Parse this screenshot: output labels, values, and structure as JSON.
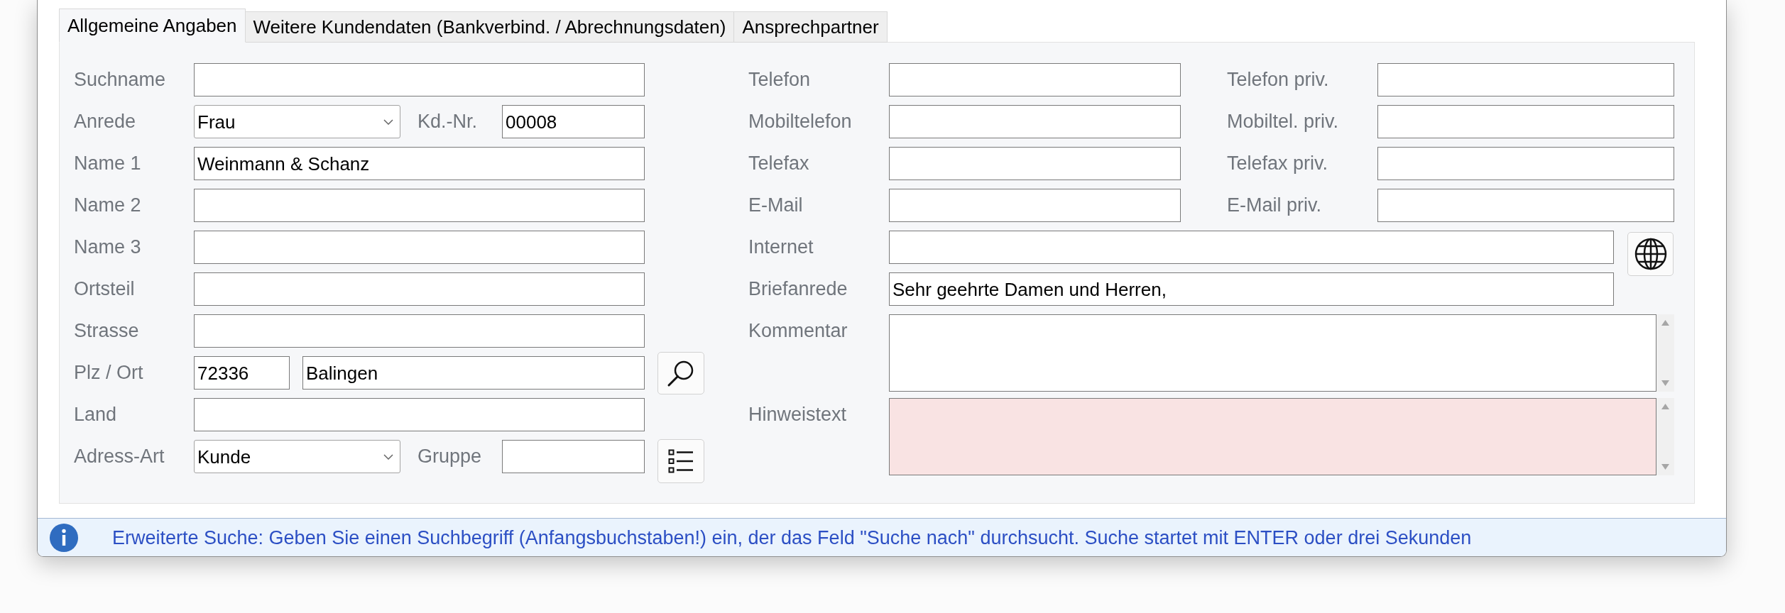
{
  "tabs": [
    {
      "label": "Allgemeine Angaben",
      "selected": true
    },
    {
      "label": "Weitere Kundendaten (Bankverbind. / Abrechnungsdaten)",
      "selected": false
    },
    {
      "label": "Ansprechpartner",
      "selected": false
    }
  ],
  "left_rows": [
    {
      "kind": "wide",
      "label": "Suchname"
    },
    {
      "kind": "split",
      "label": "Anrede",
      "select_value": "Frau",
      "label_2": "Kd.-Nr.",
      "value_2": "00008"
    },
    {
      "kind": "wide",
      "label": "Name 1",
      "value": "Weinmann & Schanz"
    },
    {
      "kind": "wide",
      "label": "Name 2"
    },
    {
      "kind": "wide",
      "label": "Name 3"
    },
    {
      "kind": "wide",
      "label": "Ortsteil"
    },
    {
      "kind": "wide",
      "label": "Strasse"
    },
    {
      "kind": "postal",
      "label": "Plz / Ort",
      "value": "72336",
      "value_2": "Balingen",
      "button": {
        "kind": "search"
      }
    },
    {
      "kind": "wide",
      "label": "Land"
    },
    {
      "kind": "split",
      "label": "Adress-Art",
      "select_value": "Kunde",
      "label_2": "Gruppe",
      "button": {
        "kind": "list"
      }
    }
  ],
  "right_rows": [
    {
      "kind": "pair",
      "label": "Telefon",
      "label_2": "Telefon priv."
    },
    {
      "kind": "pair",
      "label": "Mobiltelefon",
      "label_2": "Mobiltel. priv."
    },
    {
      "kind": "pair",
      "label": "Telefax",
      "label_2": "Telefax priv."
    },
    {
      "kind": "pair",
      "label": "E-Mail",
      "label_2": "E-Mail priv."
    },
    {
      "kind": "wide",
      "label": "Internet",
      "button": {
        "kind": "globe"
      }
    },
    {
      "kind": "wide",
      "label": "Briefanrede",
      "value": "Sehr geehrte Damen und Herren,"
    },
    {
      "kind": "memo",
      "label": "Kommentar",
      "highlighted": false
    },
    {
      "kind": "memo",
      "label": "Hinweistext",
      "highlighted": true
    }
  ],
  "status_bar": {
    "kind": "info",
    "text": "Erweiterte Suche: Geben Sie einen Suchbegriff (Anfangsbuchstaben!) ein, der das Feld \"Suche nach\" durchsucht. Suche startet mit ENTER oder drei Sekunden"
  }
}
